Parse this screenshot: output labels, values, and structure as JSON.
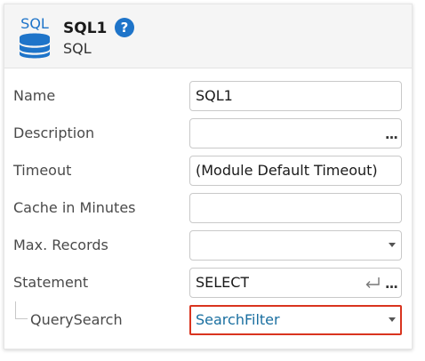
{
  "header": {
    "icon_name": "sql-database-icon",
    "icon_text": "SQL",
    "title": "SQL1",
    "subtitle": "SQL",
    "help_icon": "help-icon",
    "help_symbol": "?"
  },
  "properties": [
    {
      "label": "Name",
      "value": "SQL1"
    },
    {
      "label": "Description",
      "value": "",
      "action": "..."
    },
    {
      "label": "Timeout",
      "value": "(Module Default Timeout)"
    },
    {
      "label": "Cache in Minutes",
      "value": ""
    },
    {
      "label": "Max. Records",
      "value": "",
      "control": "dropdown"
    },
    {
      "label": "Statement",
      "value": "SELECT",
      "action": "...",
      "icon": "enter-icon"
    },
    {
      "label": "QuerySearch",
      "value": "SearchFilter",
      "control": "dropdown",
      "highlighted": true
    }
  ],
  "colors": {
    "accent": "#1e74c9",
    "highlight_border": "#d9341f",
    "link_value": "#1a6fa0"
  }
}
